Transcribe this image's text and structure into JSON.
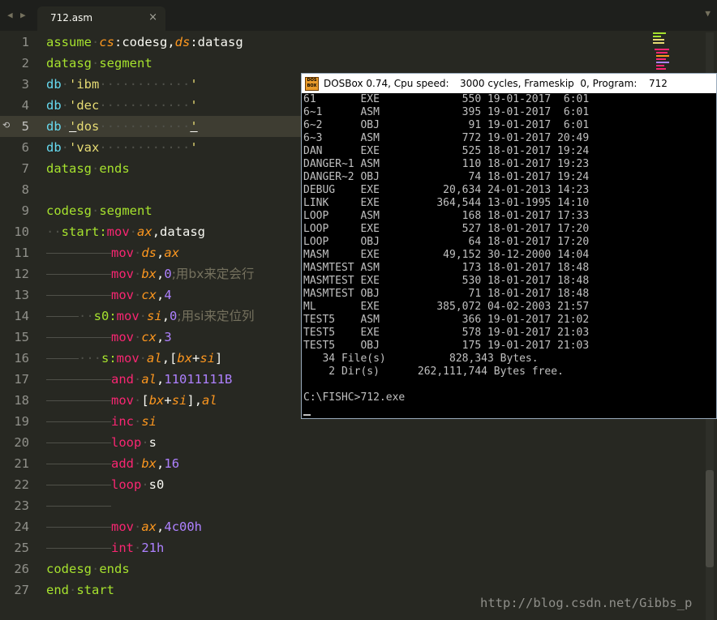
{
  "tab": {
    "filename": "712.asm",
    "close_glyph": "×",
    "prev_glyph": "◀",
    "next_glyph": "▶",
    "menu_glyph": "▼"
  },
  "editor": {
    "highlighted_line": 5,
    "lines": [
      {
        "n": "1",
        "t": [
          "assume",
          "cs",
          ":codesg,",
          "ds",
          ":datasg"
        ]
      },
      {
        "n": "2",
        "t": [
          "datasg",
          "segment"
        ]
      },
      {
        "n": "3",
        "t": [
          "db",
          "'ibm",
          "'"
        ]
      },
      {
        "n": "4",
        "t": [
          "db",
          "'dec",
          "'"
        ]
      },
      {
        "n": "5",
        "t": [
          "db",
          "'",
          "dos",
          "'"
        ]
      },
      {
        "n": "6",
        "t": [
          "db",
          "'vax",
          "'"
        ]
      },
      {
        "n": "7",
        "t": [
          "datasg",
          "ends"
        ]
      },
      {
        "n": "8",
        "t": []
      },
      {
        "n": "9",
        "t": [
          "codesg",
          "segment"
        ]
      },
      {
        "n": "10",
        "t": [
          "start:",
          "mov",
          "ax",
          ",datasg"
        ]
      },
      {
        "n": "11",
        "t": [
          "mov",
          "ds",
          ",",
          "ax"
        ]
      },
      {
        "n": "12",
        "t": [
          "mov",
          "bx",
          ",",
          "0",
          ";用bx来定会行"
        ]
      },
      {
        "n": "13",
        "t": [
          "mov",
          "cx",
          ",",
          "4"
        ]
      },
      {
        "n": "14",
        "t": [
          "s0:",
          "mov",
          "si",
          ",",
          "0",
          ";用si来定位列"
        ]
      },
      {
        "n": "15",
        "t": [
          "mov",
          "cx",
          ",",
          "3"
        ]
      },
      {
        "n": "16",
        "t": [
          "s:",
          "mov",
          "al",
          ",[",
          "bx",
          "+",
          "si",
          "]"
        ]
      },
      {
        "n": "17",
        "t": [
          "and",
          "al",
          ",",
          "11011111B"
        ]
      },
      {
        "n": "18",
        "t": [
          "mov",
          "[",
          "bx",
          "+",
          "si",
          "],",
          "al"
        ]
      },
      {
        "n": "19",
        "t": [
          "inc",
          "si"
        ]
      },
      {
        "n": "20",
        "t": [
          "loop",
          "s"
        ]
      },
      {
        "n": "21",
        "t": [
          "add",
          "bx",
          ",",
          "16"
        ]
      },
      {
        "n": "22",
        "t": [
          "loop",
          "s0"
        ]
      },
      {
        "n": "23",
        "t": []
      },
      {
        "n": "24",
        "t": [
          "mov",
          "ax",
          ",",
          "4c00h"
        ]
      },
      {
        "n": "25",
        "t": [
          "int",
          "21h"
        ]
      },
      {
        "n": "26",
        "t": [
          "codesg",
          "ends"
        ]
      },
      {
        "n": "27",
        "t": [
          "end",
          "start"
        ]
      }
    ]
  },
  "dosbox": {
    "title": "DOSBox 0.74, Cpu speed:",
    "cycles": "3000 cycles, Frameskip  0, Program:",
    "program": "712",
    "icon_text": [
      "DOS",
      "BOX"
    ],
    "listing": [
      "61       EXE             550 19-01-2017  6:01",
      "6~1      ASM             395 19-01-2017  6:01",
      "6~2      OBJ              91 19-01-2017  6:01",
      "6~3      ASM             772 19-01-2017 20:49",
      "DAN      EXE             525 18-01-2017 19:24",
      "DANGER~1 ASM             110 18-01-2017 19:23",
      "DANGER~2 OBJ              74 18-01-2017 19:24",
      "DEBUG    EXE          20,634 24-01-2013 14:23",
      "LINK     EXE         364,544 13-01-1995 14:10",
      "LOOP     ASM             168 18-01-2017 17:33",
      "LOOP     EXE             527 18-01-2017 17:20",
      "LOOP     OBJ              64 18-01-2017 17:20",
      "MASM     EXE          49,152 30-12-2000 14:04",
      "MASMTEST ASM             173 18-01-2017 18:48",
      "MASMTEST EXE             530 18-01-2017 18:48",
      "MASMTEST OBJ              71 18-01-2017 18:48",
      "ML       EXE         385,072 04-02-2003 21:57",
      "TEST5    ASM             366 19-01-2017 21:02",
      "TEST5    EXE             578 19-01-2017 21:03",
      "TEST5    OBJ             175 19-01-2017 21:03",
      "   34 File(s)          828,343 Bytes.",
      "    2 Dir(s)      262,111,744 Bytes free.",
      "",
      "C:\\FISHC>712.exe"
    ]
  },
  "watermark": "http://blog.csdn.net/Gibbs_p",
  "colors": {
    "bg": "#272822",
    "keyword": "#a6e22e",
    "instr": "#f92672",
    "register": "#fd971f",
    "number": "#ae81ff",
    "string": "#e6db74",
    "type": "#66d9ef"
  }
}
